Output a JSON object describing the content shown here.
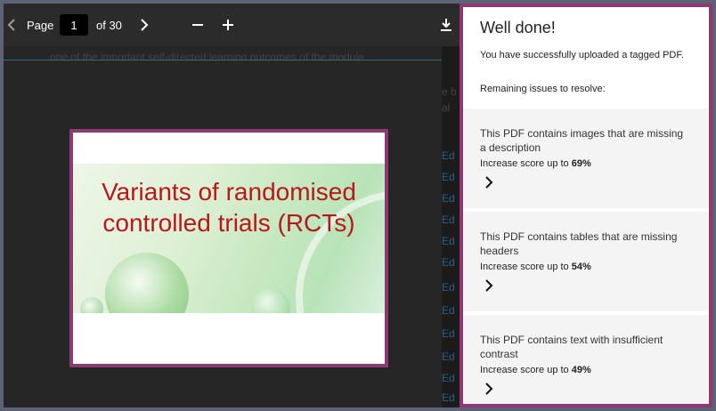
{
  "toolbar": {
    "page_label": "Page",
    "page_value": "1",
    "of_label": "of 30"
  },
  "document": {
    "visible_text": "one of the important self-directed learning outcomes of the module.",
    "side_text_1": "e b",
    "side_text_2": "al",
    "side_links": [
      "Ed",
      "Ed",
      "Ed",
      "Ed",
      "Ed",
      "Ed",
      "Ed",
      "Ed",
      "Ed",
      "Ed",
      "Ed",
      "Ed"
    ]
  },
  "slide": {
    "title_line1": "Variants of randomised",
    "title_line2": "controlled trials (RCTs)"
  },
  "panel": {
    "title": "Well done!",
    "message": "You have successfully uploaded a tagged PDF.",
    "remaining": "Remaining issues to resolve:",
    "issues": [
      {
        "text": "This PDF contains images that are missing a description",
        "score_prefix": "Increase score up to ",
        "score": "69%"
      },
      {
        "text": "This PDF contains tables that are missing headers",
        "score_prefix": "Increase score up to ",
        "score": "54%"
      },
      {
        "text": "This PDF contains text with insufficient contrast",
        "score_prefix": "Increase score up to ",
        "score": "49%"
      }
    ]
  },
  "colors": {
    "accent_border": "#8e3a72",
    "slide_title": "#b81818"
  }
}
